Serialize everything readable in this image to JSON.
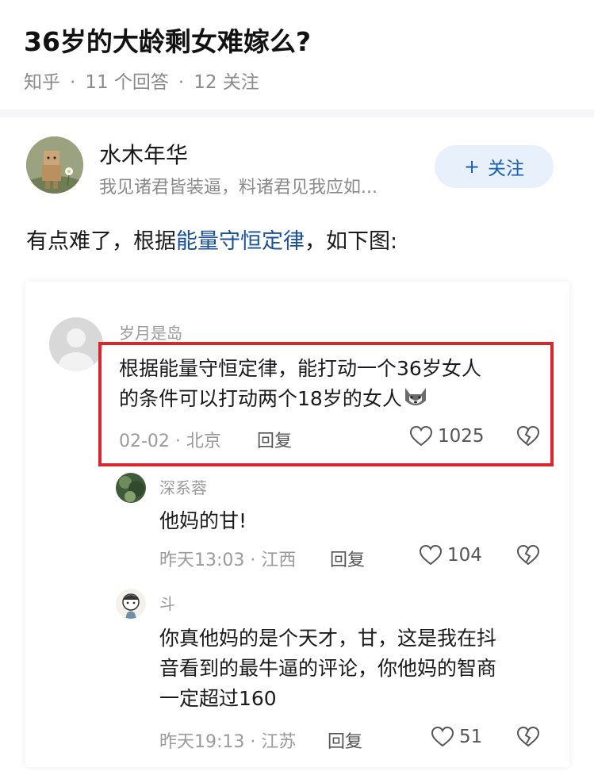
{
  "question": {
    "title": "36岁的大龄剩女难嫁么?",
    "source": "知乎",
    "answers_count": "11 个回答",
    "follow_count": "12 关注"
  },
  "author": {
    "name": "水木年华",
    "bio": "我见诸君皆装逼，料诸君见我应如...",
    "follow_label": "关注",
    "follow_plus": "+"
  },
  "answer": {
    "text_before": "有点难了，根据",
    "link_text": "能量守恒定律",
    "text_after": "，如下图:"
  },
  "comments": [
    {
      "username": "岁月是岛",
      "text_line1": "根据能量守恒定律，能打动一个36岁女人",
      "text_line2": "的条件可以打动两个18岁的女人",
      "date": "02-02",
      "location": "北京",
      "reply_label": "回复",
      "likes": "1025"
    },
    {
      "username": "深系蓉",
      "text": "他妈的甘!",
      "date": "昨天13:03",
      "location": "江西",
      "reply_label": "回复",
      "likes": "104"
    },
    {
      "username": "斗",
      "text_line1": "你真他妈的是个天才，甘，这是我在抖",
      "text_line2": "音看到的最牛逼的评论，你他妈的智商",
      "text_line3": "一定超过160",
      "date": "昨天19:13",
      "location": "江苏",
      "reply_label": "回复",
      "likes": "51"
    }
  ],
  "colors": {
    "link": "#175199",
    "highlight_border": "#d8262b",
    "follow_bg": "#e8f0fb"
  }
}
